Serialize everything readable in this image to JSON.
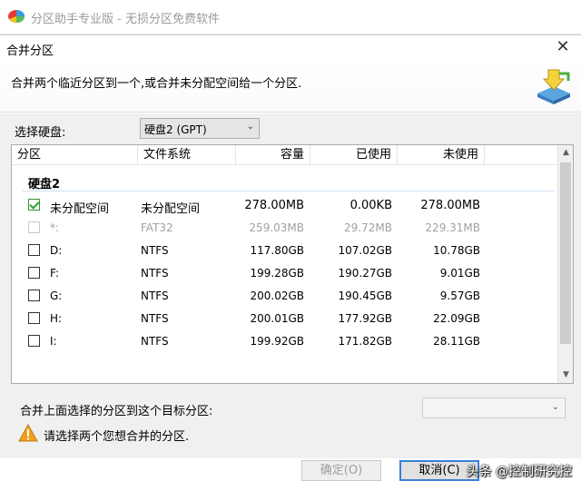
{
  "app": {
    "title": "分区助手专业版 - 无损分区免费软件"
  },
  "dialog": {
    "title": "合并分区",
    "close_label": "✕",
    "instruction": "合并两个临近分区到一个,或合并未分配空间给一个分区."
  },
  "disk_selector": {
    "label": "选择硬盘:",
    "value": "硬盘2 (GPT)"
  },
  "table": {
    "columns": [
      "分区",
      "文件系统",
      "容量",
      "已使用",
      "未使用"
    ],
    "group_label": "硬盘2",
    "rows": [
      {
        "checked": true,
        "disabled": false,
        "partition": "未分配空间",
        "fs": "未分配空间",
        "capacity": "278.00MB",
        "used": "0.00KB",
        "unused": "278.00MB"
      },
      {
        "checked": false,
        "disabled": true,
        "partition": "*:",
        "fs": "FAT32",
        "capacity": "259.03MB",
        "used": "29.72MB",
        "unused": "229.31MB"
      },
      {
        "checked": false,
        "disabled": false,
        "partition": "D:",
        "fs": "NTFS",
        "capacity": "117.80GB",
        "used": "107.02GB",
        "unused": "10.78GB"
      },
      {
        "checked": false,
        "disabled": false,
        "partition": "F:",
        "fs": "NTFS",
        "capacity": "199.28GB",
        "used": "190.27GB",
        "unused": "9.01GB"
      },
      {
        "checked": false,
        "disabled": false,
        "partition": "G:",
        "fs": "NTFS",
        "capacity": "200.02GB",
        "used": "190.45GB",
        "unused": "9.57GB"
      },
      {
        "checked": false,
        "disabled": false,
        "partition": "H:",
        "fs": "NTFS",
        "capacity": "200.01GB",
        "used": "177.92GB",
        "unused": "22.09GB"
      },
      {
        "checked": false,
        "disabled": false,
        "partition": "I:",
        "fs": "NTFS",
        "capacity": "199.92GB",
        "used": "171.82GB",
        "unused": "28.11GB"
      }
    ]
  },
  "target": {
    "label": "合并上面选择的分区到这个目标分区:",
    "value": ""
  },
  "warning": {
    "icon": "warning-icon",
    "text": "请选择两个您想合并的分区."
  },
  "buttons": {
    "ok_label": "确定(O)",
    "cancel_label": "取消(C)"
  },
  "watermark": "头条 @控制研究控",
  "colors": {
    "check_green": "#2a9d2a",
    "warning_orange": "#f0a020",
    "focus_blue": "#3c7fd6"
  }
}
